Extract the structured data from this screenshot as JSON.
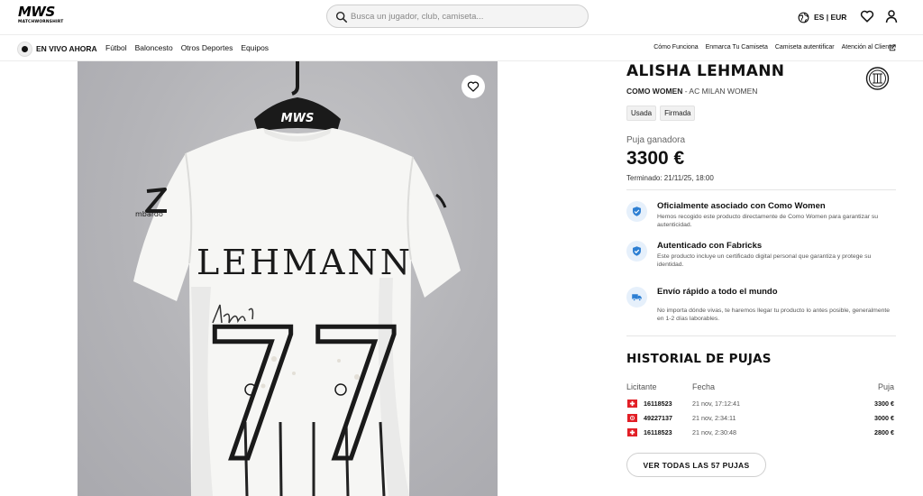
{
  "header": {
    "logo_text": "MWS",
    "logo_subtext": "MATCHWORNSHIRT",
    "search_placeholder": "Busca un jugador, club, camiseta...",
    "locale": "ES | EUR"
  },
  "nav": {
    "live_label": "EN VIVO AHORA",
    "categories": [
      "Fútbol",
      "Baloncesto",
      "Otros Deportes",
      "Equipos"
    ],
    "links": [
      "Cómo Funciona",
      "Enmarca Tu Camiseta",
      "Camiseta autentificar",
      "Atención al Cliente"
    ]
  },
  "product": {
    "player_name": "ALISHA LEHMANN",
    "team": "COMO WOMEN",
    "team_suffix": " - AC MILAN WOMEN",
    "tags": [
      "Usada",
      "Firmada"
    ],
    "bid_label": "Puja ganadora",
    "price": "3300 €",
    "ended": "Terminado: 21/11/25, 18:00",
    "jersey_name": "LEHMANN",
    "jersey_number": "77",
    "hanger_text": "MWS",
    "sleeve_text": "mbardo"
  },
  "features": [
    {
      "icon": "shield-handshake-icon",
      "title": "Oficialmente asociado con Como Women",
      "desc": "Hemos recogido este producto directamente de Como Women para garantizar su autenticidad."
    },
    {
      "icon": "check-shield-icon",
      "title": "Autenticado con Fabricks",
      "desc": "Este producto incluye un certificado digital personal que garantiza y protege su identidad."
    },
    {
      "icon": "truck-icon",
      "title": "Envío rápido a todo el mundo",
      "desc": "No importa dónde vivas, te haremos llegar tu producto lo antes posible, generalmente en 1-2 días laborables."
    }
  ],
  "history": {
    "title": "HISTORIAL DE PUJAS",
    "columns": [
      "Licitante",
      "Fecha",
      "Puja"
    ],
    "rows": [
      {
        "bidder": "16118523",
        "date": "21 nov, 17:12:41",
        "amount": "3300 €"
      },
      {
        "bidder": "49227137",
        "date": "21 nov, 2:34:11",
        "amount": "3000 €"
      },
      {
        "bidder": "16118523",
        "date": "21 nov, 2:30:48",
        "amount": "2800 €"
      }
    ],
    "all_bids_label": "VER TODAS LAS 57 PUJAS"
  },
  "colors": {
    "accent_blue": "#2d7fd3",
    "flag_red": "#e21f26",
    "photo_bg": "#b9b9bd"
  }
}
